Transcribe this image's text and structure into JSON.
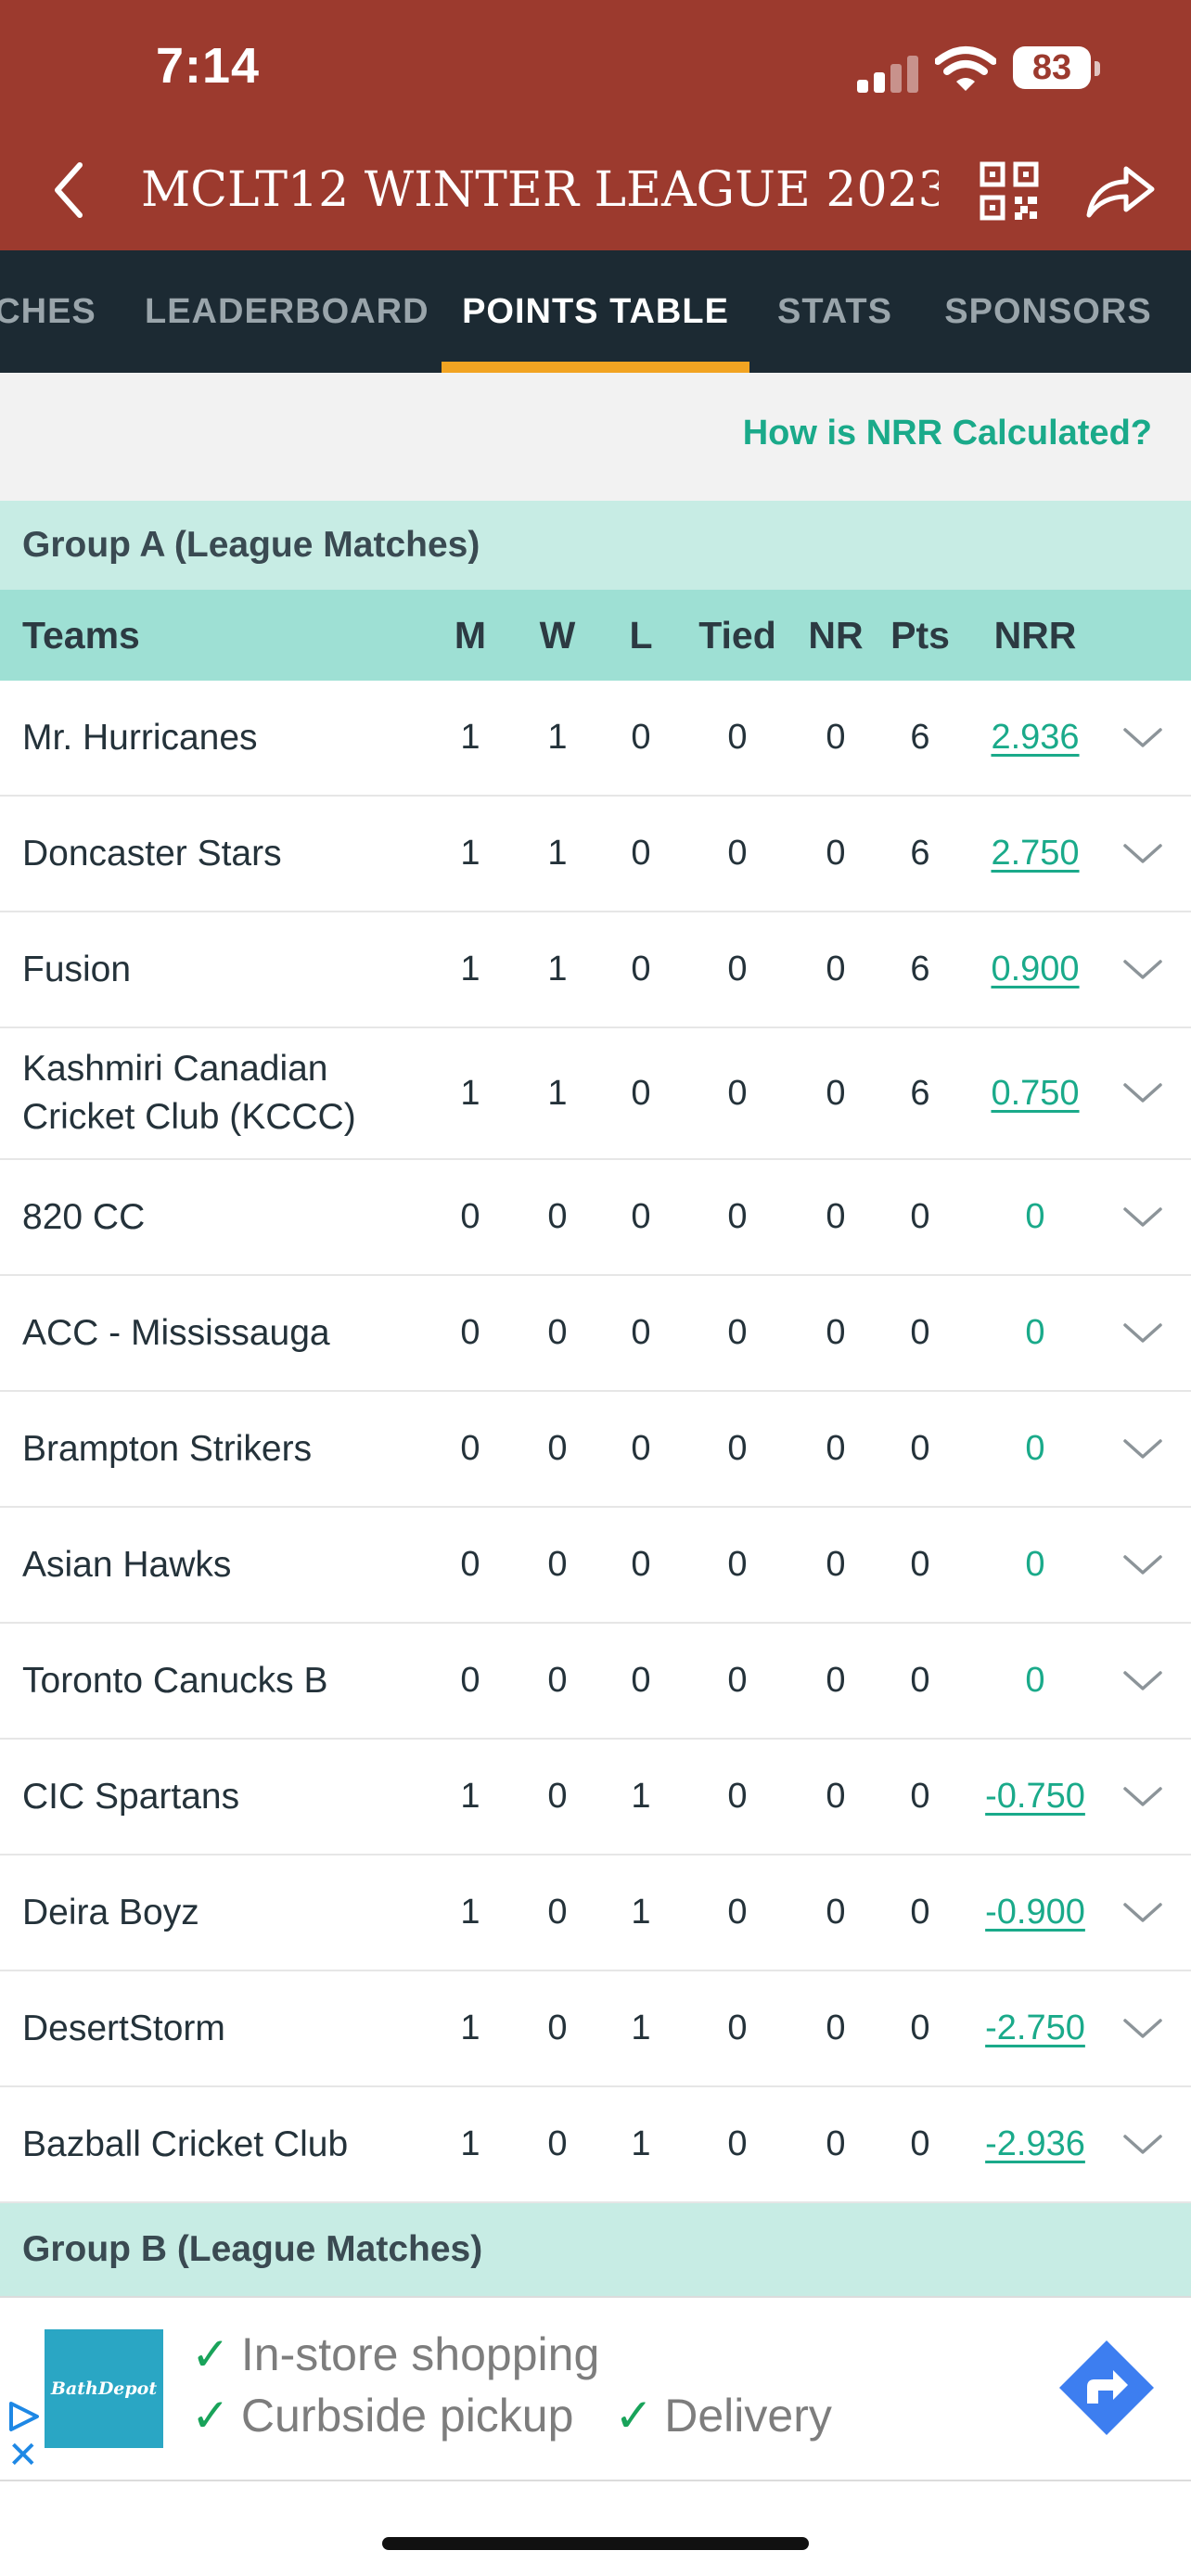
{
  "status_bar": {
    "time": "7:14",
    "battery": "83"
  },
  "header": {
    "title": "MCLT12 WINTER LEAGUE 2023-..."
  },
  "tabs": [
    {
      "label": "CHES"
    },
    {
      "label": "LEADERBOARD"
    },
    {
      "label": "POINTS TABLE",
      "active": true
    },
    {
      "label": "STATS"
    },
    {
      "label": "SPONSORS"
    }
  ],
  "nrr_link": "How is NRR Calculated?",
  "group_a": {
    "title": "Group A (League Matches)"
  },
  "columns": {
    "teams": "Teams",
    "m": "M",
    "w": "W",
    "l": "L",
    "tied": "Tied",
    "nr": "NR",
    "pts": "Pts",
    "nrr": "NRR"
  },
  "rows": [
    {
      "team": "Mr. Hurricanes",
      "m": "1",
      "w": "1",
      "l": "0",
      "tied": "0",
      "nr": "0",
      "pts": "6",
      "nrr": "2.936"
    },
    {
      "team": "Doncaster Stars",
      "m": "1",
      "w": "1",
      "l": "0",
      "tied": "0",
      "nr": "0",
      "pts": "6",
      "nrr": "2.750"
    },
    {
      "team": "Fusion",
      "m": "1",
      "w": "1",
      "l": "0",
      "tied": "0",
      "nr": "0",
      "pts": "6",
      "nrr": "0.900"
    },
    {
      "team": "Kashmiri Canadian Cricket Club (KCCC)",
      "m": "1",
      "w": "1",
      "l": "0",
      "tied": "0",
      "nr": "0",
      "pts": "6",
      "nrr": "0.750"
    },
    {
      "team": "820 CC",
      "m": "0",
      "w": "0",
      "l": "0",
      "tied": "0",
      "nr": "0",
      "pts": "0",
      "nrr": "0"
    },
    {
      "team": "ACC - Mississauga",
      "m": "0",
      "w": "0",
      "l": "0",
      "tied": "0",
      "nr": "0",
      "pts": "0",
      "nrr": "0"
    },
    {
      "team": "Brampton Strikers",
      "m": "0",
      "w": "0",
      "l": "0",
      "tied": "0",
      "nr": "0",
      "pts": "0",
      "nrr": "0"
    },
    {
      "team": "Asian Hawks",
      "m": "0",
      "w": "0",
      "l": "0",
      "tied": "0",
      "nr": "0",
      "pts": "0",
      "nrr": "0"
    },
    {
      "team": "Toronto Canucks B",
      "m": "0",
      "w": "0",
      "l": "0",
      "tied": "0",
      "nr": "0",
      "pts": "0",
      "nrr": "0"
    },
    {
      "team": "CIC Spartans",
      "m": "1",
      "w": "0",
      "l": "1",
      "tied": "0",
      "nr": "0",
      "pts": "0",
      "nrr": "-0.750"
    },
    {
      "team": "Deira Boyz",
      "m": "1",
      "w": "0",
      "l": "1",
      "tied": "0",
      "nr": "0",
      "pts": "0",
      "nrr": "-0.900"
    },
    {
      "team": "DesertStorm",
      "m": "1",
      "w": "0",
      "l": "1",
      "tied": "0",
      "nr": "0",
      "pts": "0",
      "nrr": "-2.750"
    },
    {
      "team": "Bazball Cricket Club",
      "m": "1",
      "w": "0",
      "l": "1",
      "tied": "0",
      "nr": "0",
      "pts": "0",
      "nrr": "-2.936"
    }
  ],
  "group_b": {
    "title": "Group B (League Matches)"
  },
  "ad": {
    "brand": "BathDepot",
    "line1": "In-store shopping",
    "line2a": "Curbside pickup",
    "line2b": "Delivery",
    "check_glyph": "✓",
    "close_glyph": "✕"
  },
  "colors": {
    "header_bg": "#9c3a2e",
    "tabs_bg": "#1c2a33",
    "accent": "#f2a422",
    "link": "#1aaa8a",
    "group_bg": "#c7ece4",
    "colhdr_bg": "#9ee0d4"
  }
}
